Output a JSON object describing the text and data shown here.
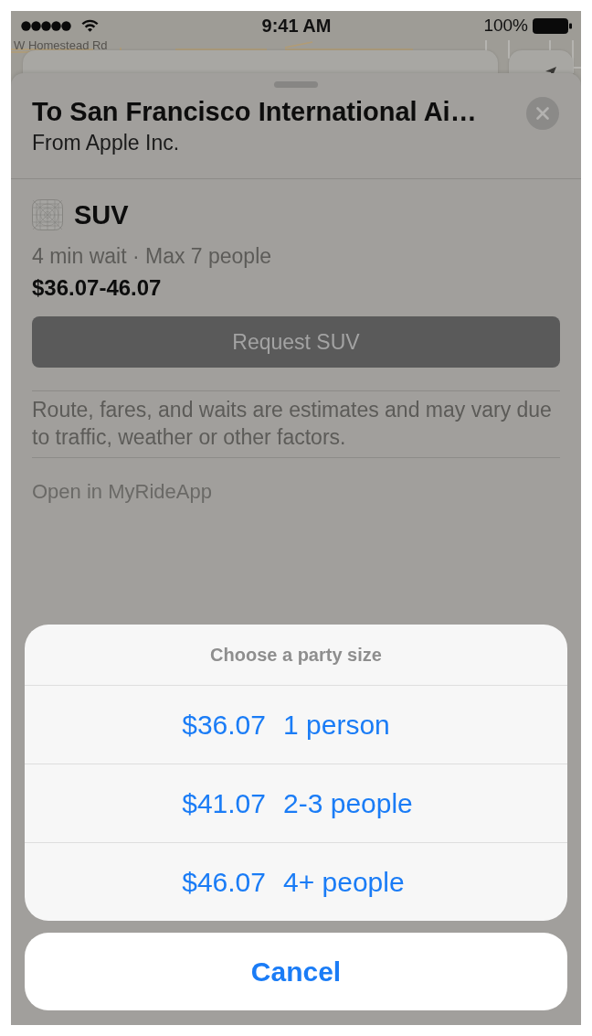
{
  "status_bar": {
    "time": "9:41 AM",
    "battery": "100%"
  },
  "map": {
    "street_label": "W Homestead Rd"
  },
  "sheet": {
    "title": "To San Francisco International Ai…",
    "subtitle": "From Apple Inc.",
    "ride": {
      "name": "SUV",
      "details": "4 min wait · Max 7 people",
      "price_range": "$36.07-46.07",
      "request_button": "Request SUV"
    },
    "disclaimer": "Route, fares, and waits are estimates and may vary due to traffic, weather or other factors.",
    "open_link": "Open in MyRideApp"
  },
  "action_sheet": {
    "title": "Choose a party size",
    "options": [
      {
        "price": "$36.07",
        "label": "1 person"
      },
      {
        "price": "$41.07",
        "label": "2-3 people"
      },
      {
        "price": "$46.07",
        "label": "4+ people"
      }
    ],
    "cancel": "Cancel"
  }
}
